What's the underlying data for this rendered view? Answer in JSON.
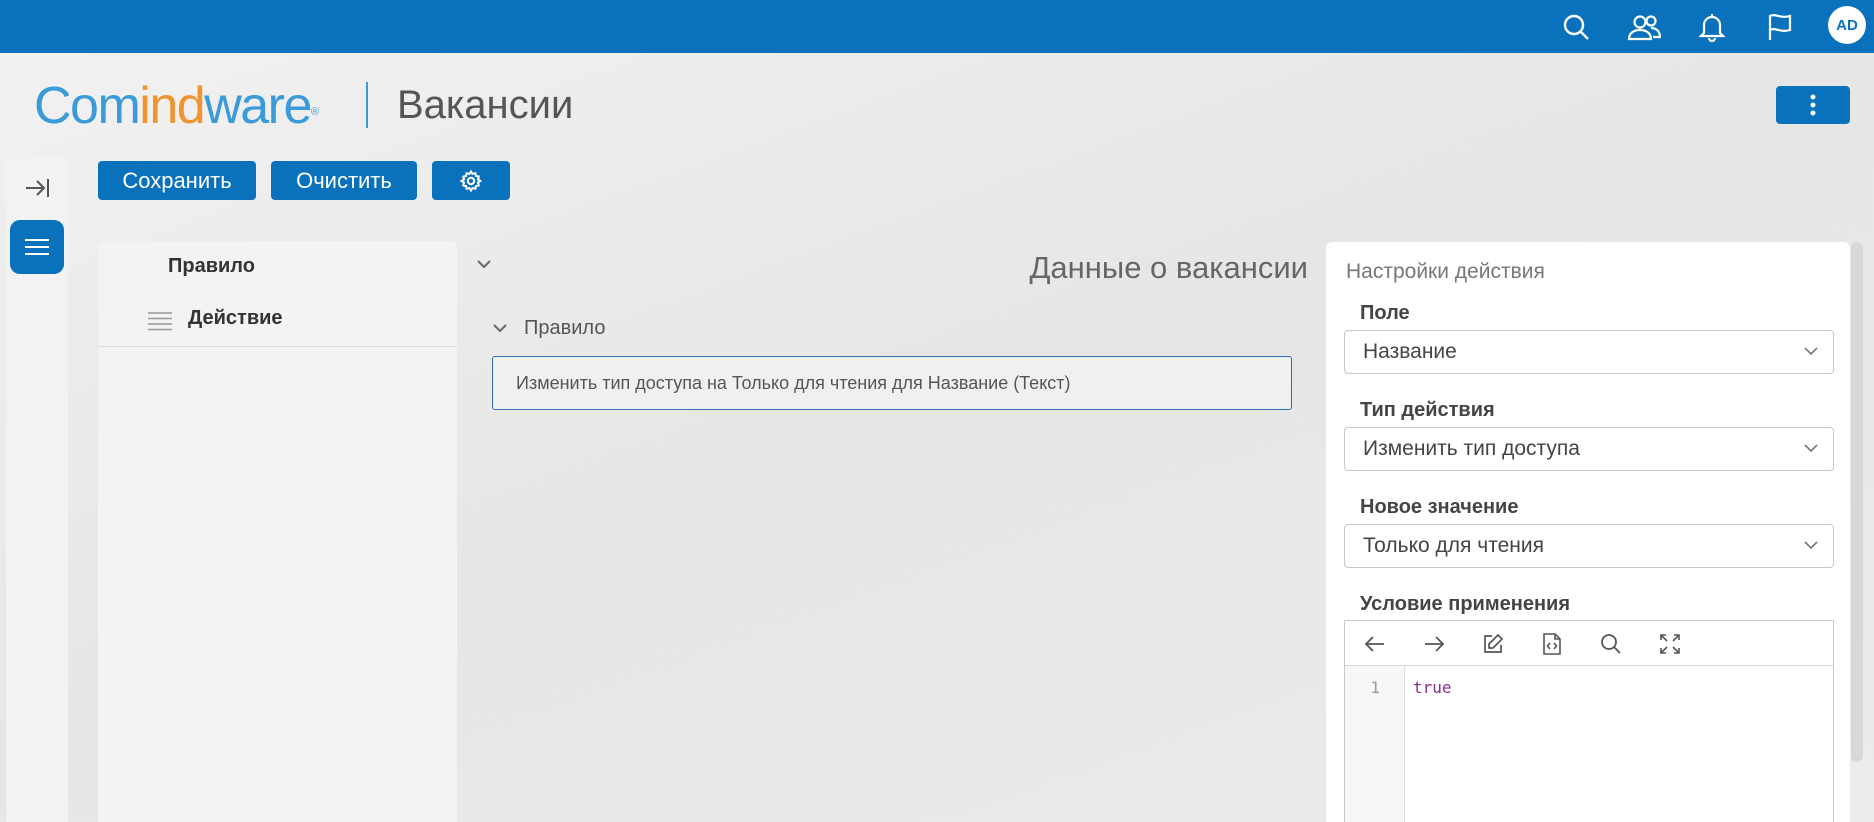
{
  "topbar": {
    "icons": [
      "search-icon",
      "users-icon",
      "bell-icon",
      "flag-icon"
    ],
    "avatar_initials": "AD",
    "color": "#0a72bd"
  },
  "header": {
    "logo": {
      "part1": "Com",
      "part2": "ind",
      "part3": "ware",
      "reg": "®"
    },
    "title": "Вакансии"
  },
  "toolbar": {
    "save_label": "Сохранить",
    "clear_label": "Очистить",
    "settings_icon": "gear-icon"
  },
  "tree": {
    "rule_label": "Правило",
    "action_label": "Действие"
  },
  "main": {
    "section_title": "Данные о вакансии",
    "rule_header": "Правило",
    "rule_text": "Изменить тип доступа на Только для чтения для Название (Текст)"
  },
  "settings": {
    "title": "Настройки действия",
    "field_label": "Поле",
    "field_value": "Название",
    "action_type_label": "Тип действия",
    "action_type_value": "Изменить тип доступа",
    "new_value_label": "Новое значение",
    "new_value_value": "Только для чтения",
    "condition_label": "Условие применения",
    "editor": {
      "tools": [
        "arrow-left-icon",
        "arrow-right-icon",
        "edit-icon",
        "code-file-icon",
        "search-icon",
        "fullscreen-icon"
      ],
      "line_number": "1",
      "code": "true"
    }
  }
}
